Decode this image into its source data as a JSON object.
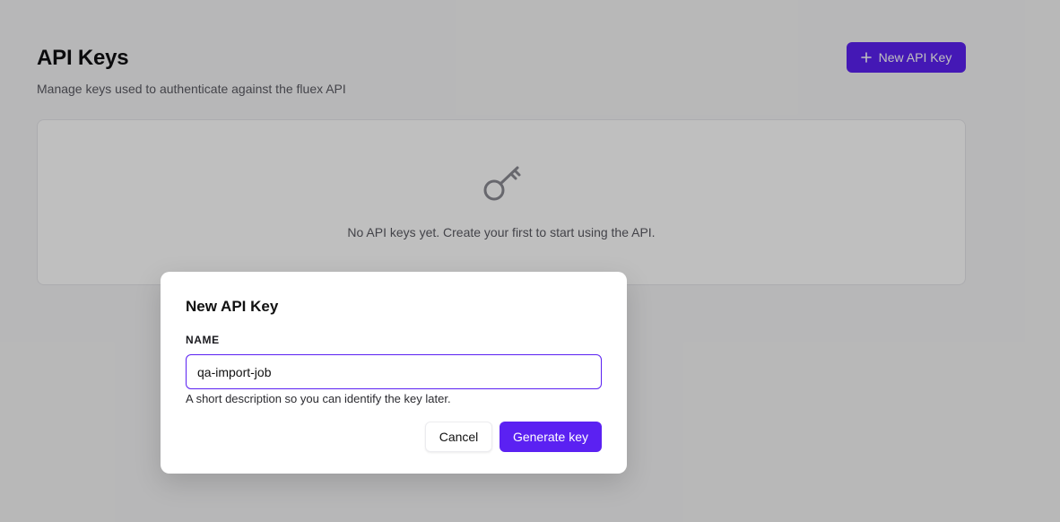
{
  "page": {
    "title": "API Keys",
    "subtitle": "Manage keys used to authenticate against the fluex API",
    "new_key_button_label": "New API Key"
  },
  "empty_state": {
    "icon": "key-icon",
    "message": "No API keys yet. Create your first to start using the API."
  },
  "dialog": {
    "title": "New API Key",
    "name_label": "NAME",
    "name_value": "qa-import-job",
    "name_help": "A short description so you can identify the key later.",
    "cancel_label": "Cancel",
    "generate_label": "Generate key"
  },
  "colors": {
    "accent": "#5b21f2",
    "backdrop": "#b8b8b8"
  }
}
